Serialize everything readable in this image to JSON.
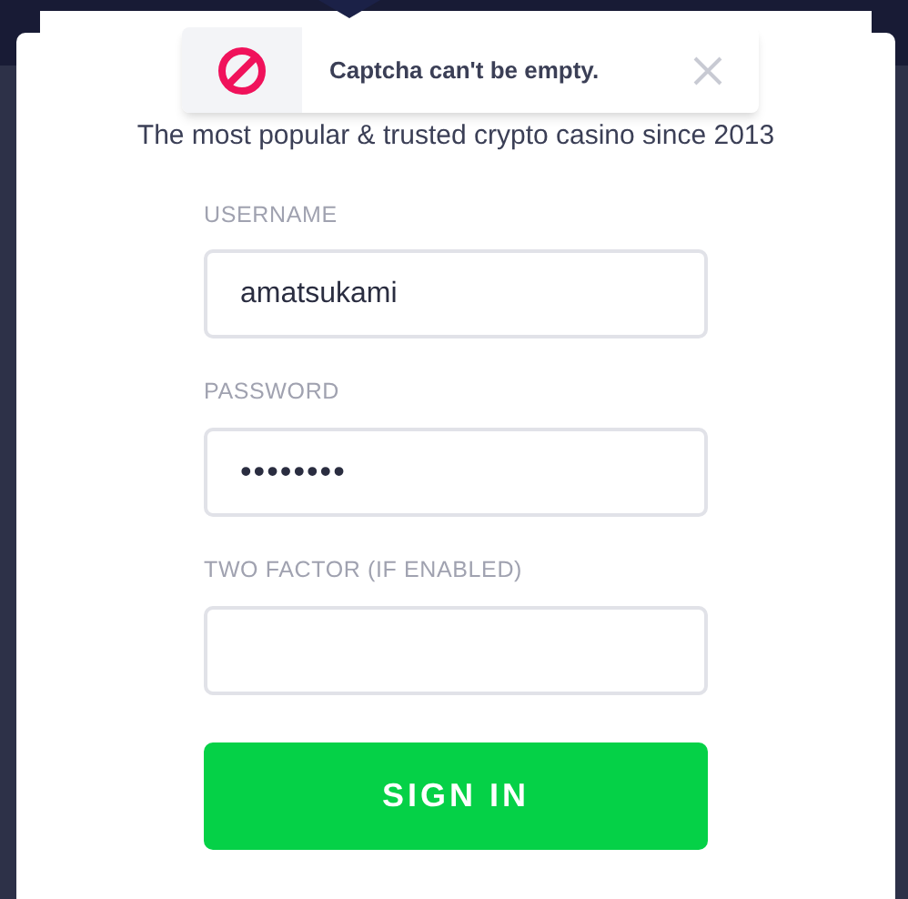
{
  "toast": {
    "message": "Captcha can't be empty."
  },
  "tagline": "The most popular & trusted crypto casino since 2013",
  "fields": [
    {
      "label": "USERNAME",
      "value": "amatsukami",
      "kind": "text"
    },
    {
      "label": "PASSWORD",
      "value": "••••••••",
      "kind": "password"
    },
    {
      "label": "TWO FACTOR (IF ENABLED)",
      "kind": "text"
    }
  ],
  "submit": "SIGN IN"
}
